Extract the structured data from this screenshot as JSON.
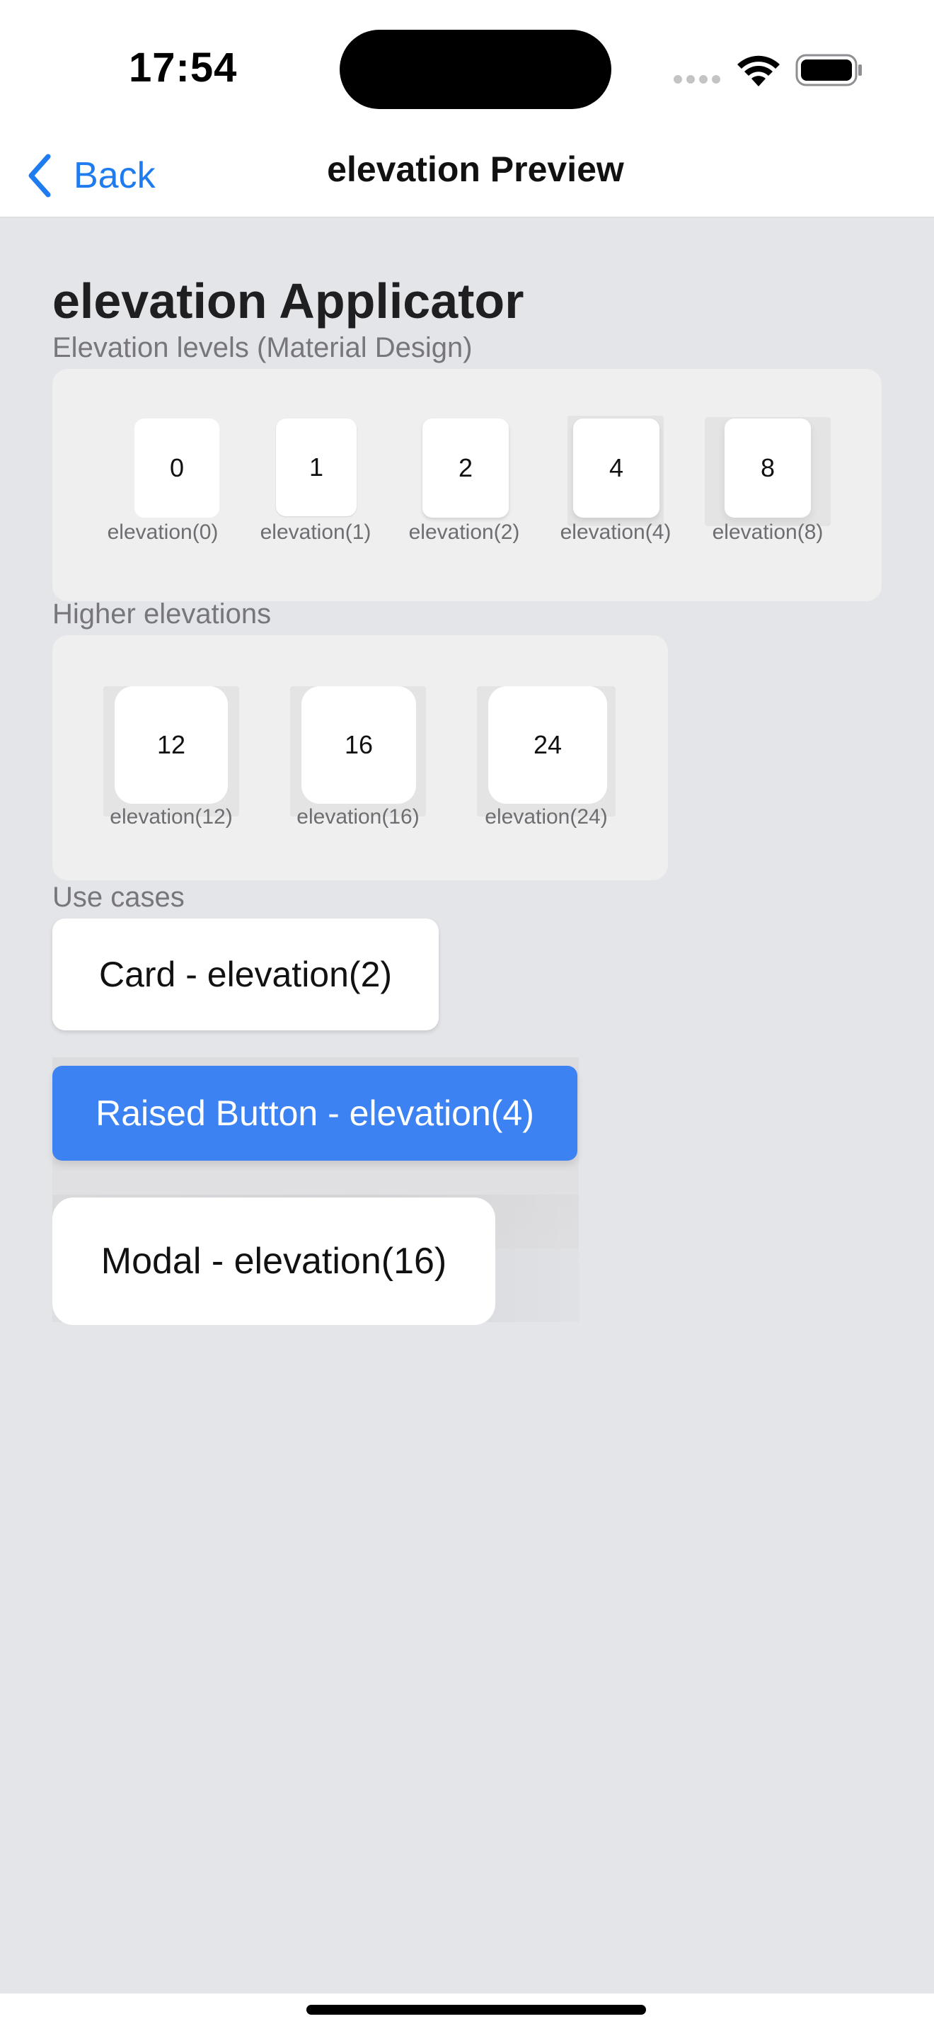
{
  "status_bar": {
    "time": "17:54",
    "icons": [
      "cellular-signal-icon",
      "wifi-icon",
      "battery-icon"
    ]
  },
  "nav": {
    "back_label": "Back",
    "title": "elevation Preview"
  },
  "page": {
    "title": "elevation Applicator"
  },
  "sections": {
    "levels_label": "Elevation levels (Material Design)",
    "higher_label": "Higher elevations",
    "use_cases_label": "Use cases"
  },
  "levels": [
    {
      "value": "0",
      "caption": "elevation(0)"
    },
    {
      "value": "1",
      "caption": "elevation(1)"
    },
    {
      "value": "2",
      "caption": "elevation(2)"
    },
    {
      "value": "4",
      "caption": "elevation(4)"
    },
    {
      "value": "8",
      "caption": "elevation(8)"
    }
  ],
  "higher": [
    {
      "value": "12",
      "caption": "elevation(12)"
    },
    {
      "value": "16",
      "caption": "elevation(16)"
    },
    {
      "value": "24",
      "caption": "elevation(24)"
    }
  ],
  "use_cases": {
    "card": "Card - elevation(2)",
    "raised_button": "Raised Button - elevation(4)",
    "modal": "Modal - elevation(16)"
  },
  "colors": {
    "accent": "#1e7bf0",
    "raised_button": "#3d82f2",
    "background": "#e4e5e9",
    "panel": "#efefef"
  }
}
